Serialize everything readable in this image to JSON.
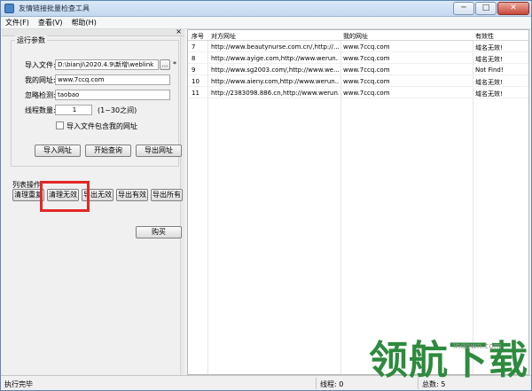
{
  "window": {
    "title": "友情链接批量检查工具",
    "min_symbol": "─",
    "max_symbol": "□",
    "close_symbol": "✕"
  },
  "menu": [
    {
      "label": "文件(F)"
    },
    {
      "label": "查看(V)"
    },
    {
      "label": "帮助(H)"
    }
  ],
  "pane": {
    "close_symbol": "×"
  },
  "params": {
    "legend": "运行参数",
    "import_file_label": "导入文件:",
    "import_file_value": "D:\\bianji\\2020.4.9\\新增\\weblink",
    "browse_label": "...",
    "asterisk": "*",
    "my_url_label": "我的网址:",
    "my_url_value": "www.7ccq.com",
    "ignore_label": "忽略检测:",
    "ignore_value": "taobao",
    "threads_label": "线程数量:",
    "threads_value": "1",
    "threads_hint": "(1~30之间)",
    "include_my_url_label": "导入文件包含我的网址",
    "include_my_url_checked": false
  },
  "actions": {
    "import_url": "导入网址",
    "start_query": "开始查询",
    "export_url": "导出网址"
  },
  "list_ops": {
    "label": "列表操作",
    "clear_repeat": "清理重复",
    "clear_invalid": "清理无效",
    "export_invalid": "导出无效",
    "export_valid": "导出有效",
    "export_all": "导出所有"
  },
  "buy": "购买",
  "table": {
    "headers": [
      "序号",
      "对方网址",
      "我的网址",
      "有效性"
    ],
    "rows": [
      {
        "index": "7",
        "their_url": "http://www.beautynurse.com.cn/,http://...",
        "my_url": "www.7ccq.com",
        "validity": "域名无效!"
      },
      {
        "index": "8",
        "their_url": "http://www.ayige.com,http://www.werun...",
        "my_url": "www.7ccq.com",
        "validity": "域名无效!"
      },
      {
        "index": "9",
        "their_url": "http://www.sg2003.com/,http://www.we...",
        "my_url": "www.7ccq.com",
        "validity": "Not Find!"
      },
      {
        "index": "10",
        "their_url": "http://www.aieny.com,http://www.werun...",
        "my_url": "www.7ccq.com",
        "validity": "域名无效!"
      },
      {
        "index": "11",
        "their_url": "http://2383098.886.cn,http://www.werun...",
        "my_url": "www.7ccq.com",
        "validity": "域名无效!"
      }
    ]
  },
  "status": {
    "text": "执行完毕",
    "threads": "线程: 0",
    "total": "总数: 5"
  },
  "watermark": {
    "brand": "领航下载",
    "site": "lhdown.com",
    "brand_color": "#2e8a3e"
  },
  "colors": {
    "highlight": "#e32727",
    "title_bg": "#c4d8ef"
  }
}
